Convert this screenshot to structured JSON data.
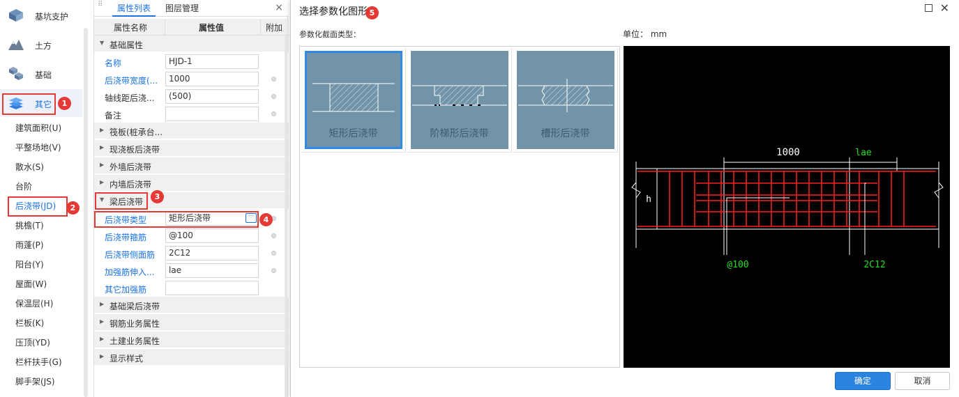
{
  "left_nav": {
    "categories": [
      {
        "label": "基坑支护",
        "icon": "pit-support-icon"
      },
      {
        "label": "土方",
        "icon": "earthwork-icon"
      },
      {
        "label": "基础",
        "icon": "foundation-icon"
      },
      {
        "label": "其它",
        "icon": "layers-icon"
      }
    ],
    "items": [
      "建筑面积(U)",
      "平整场地(V)",
      "散水(S)",
      "台阶",
      "后浇带(JD)",
      "挑檐(T)",
      "雨蓬(P)",
      "阳台(Y)",
      "屋面(W)",
      "保温层(H)",
      "栏板(K)",
      "压顶(YD)",
      "栏杆扶手(G)",
      "脚手架(JS)"
    ]
  },
  "prop_panel": {
    "tabs": [
      "属性列表",
      "图层管理"
    ],
    "close_glyph": "×",
    "columns": [
      "属性名称",
      "属性值",
      "附加"
    ],
    "groups": {
      "base": "基础属性",
      "raft": "筏板(桩承台...",
      "slab": "现浇板后浇带",
      "outer_wall": "外墙后浇带",
      "inner_wall": "内墙后浇带",
      "beam": "梁后浇带",
      "found_beam": "基础梁后浇带",
      "rebar": "钢筋业务属性",
      "civil": "土建业务属性",
      "display": "显示样式"
    },
    "rows": {
      "name": {
        "key": "名称",
        "value": "HJD-1"
      },
      "width": {
        "key": "后浇带宽度(...",
        "value": "1000"
      },
      "axis": {
        "key": "轴线距后浇...",
        "value": "(500)"
      },
      "note": {
        "key": "备注",
        "value": ""
      },
      "type": {
        "key": "后浇带类型",
        "value": "矩形后浇带",
        "button": "···"
      },
      "stirrup": {
        "key": "后浇带箍筋",
        "value": "@100"
      },
      "side": {
        "key": "后浇带侧面筋",
        "value": "2C12"
      },
      "extend": {
        "key": "加强筋伸入...",
        "value": "lae"
      },
      "other": {
        "key": "其它加强筋",
        "value": ""
      }
    }
  },
  "dialog": {
    "title": "选择参数化图形",
    "section_label": "参数化截面类型：",
    "unit_label": "单位：  mm",
    "shapes": [
      "矩形后浇带",
      "阶梯形后浇带",
      "槽形后浇带"
    ],
    "preview": {
      "dim_width": "1000",
      "dim_lae": "lae",
      "h_label": "h",
      "stirrup_label": "@100",
      "side_label": "2C12"
    },
    "ok": "确定",
    "cancel": "取消"
  },
  "annotations": [
    "1",
    "2",
    "3",
    "4",
    "5"
  ],
  "colors": {
    "accent": "#1a73e8",
    "annotation": "#e53935",
    "rebar": "#ff2020",
    "preview_text": "#22dd22"
  }
}
